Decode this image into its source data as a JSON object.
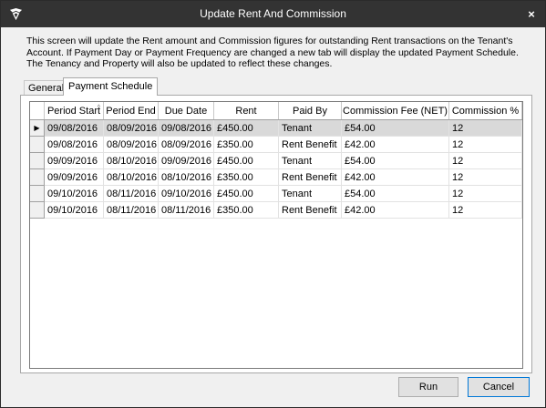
{
  "window": {
    "title": "Update Rent And Commission",
    "close_glyph": "×"
  },
  "description": "This screen will update the Rent amount and Commission figures for outstanding Rent transactions on the Tenant's Account. If Payment Day or Payment Frequency are changed a new tab will display the updated Payment Schedule. The Tenancy and Property will also be updated to reflect these changes.",
  "tabs": [
    {
      "label": "General",
      "active": false
    },
    {
      "label": "Payment Schedule",
      "active": true
    }
  ],
  "grid": {
    "columns": [
      "Period Start",
      "Period End",
      "Due Date",
      "Rent",
      "Paid By",
      "Commission Fee (NET)",
      "Commission %"
    ],
    "sort_indicator": "^",
    "current_row_marker": "▶",
    "rows": [
      [
        "09/08/2016",
        "08/09/2016",
        "09/08/2016",
        "£450.00",
        "Tenant",
        "£54.00",
        "12"
      ],
      [
        "09/08/2016",
        "08/09/2016",
        "08/09/2016",
        "£350.00",
        "Rent Benefit",
        "£42.00",
        "12"
      ],
      [
        "09/09/2016",
        "08/10/2016",
        "09/09/2016",
        "£450.00",
        "Tenant",
        "£54.00",
        "12"
      ],
      [
        "09/09/2016",
        "08/10/2016",
        "08/10/2016",
        "£350.00",
        "Rent Benefit",
        "£42.00",
        "12"
      ],
      [
        "09/10/2016",
        "08/11/2016",
        "09/10/2016",
        "£450.00",
        "Tenant",
        "£54.00",
        "12"
      ],
      [
        "09/10/2016",
        "08/11/2016",
        "08/11/2016",
        "£350.00",
        "Rent Benefit",
        "£42.00",
        "12"
      ]
    ],
    "selected_row": 0
  },
  "buttons": {
    "run": "Run",
    "cancel": "Cancel"
  },
  "icons": {
    "app": "app-logo-icon",
    "close": "close-icon"
  }
}
